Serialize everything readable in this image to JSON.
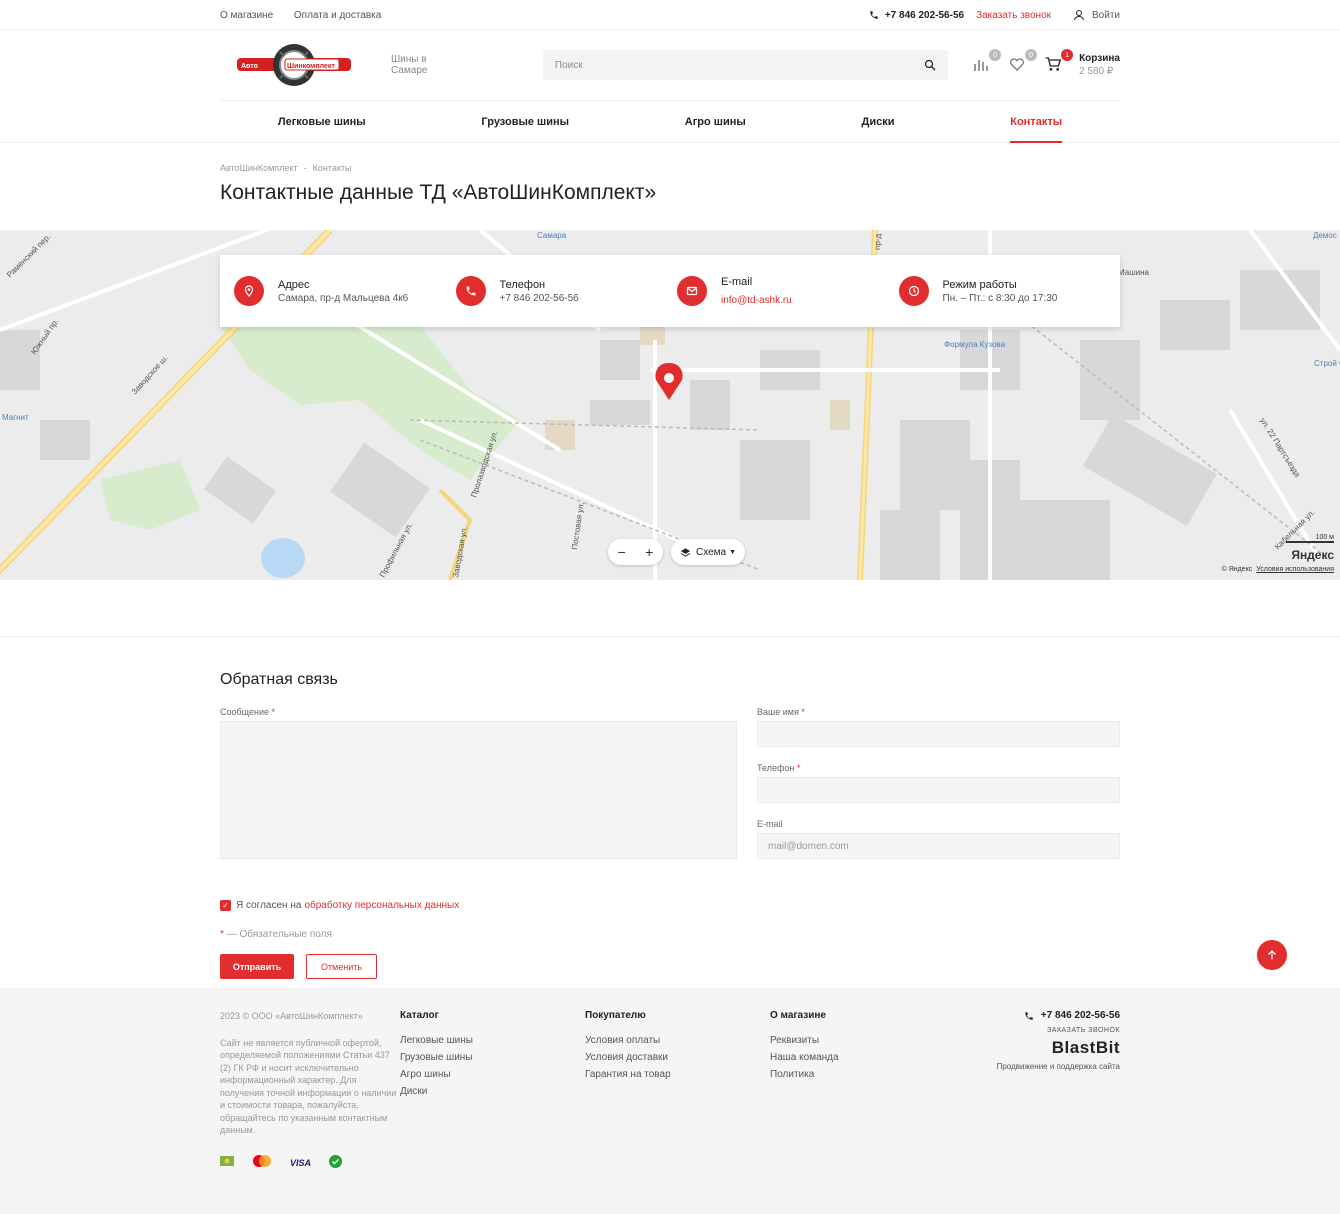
{
  "topbar": {
    "links": [
      "О магазине",
      "Оплата и доставка"
    ],
    "phone": "+7 846 202-56-56",
    "callback": "Заказать звонок",
    "login": "Войти"
  },
  "header": {
    "logo_text_left": "Авто",
    "logo_text_right": "Шинкомплект",
    "slogan": "Шины в Самаре",
    "search_placeholder": "Поиск",
    "compare_count": "0",
    "favorites_count": "0",
    "cart_count": "1",
    "cart_label": "Корзина",
    "cart_total": "2 580 ₽"
  },
  "nav": {
    "items": [
      "Легковые шины",
      "Грузовые шины",
      "Агро шины",
      "Диски",
      "Контакты"
    ],
    "active": "Контакты"
  },
  "breadcrumbs": [
    "АвтоШинКомплект",
    "Контакты"
  ],
  "breadcrumb_sep": "-",
  "page_title": "Контактные данные ТД «АвтоШинКомплект»",
  "contacts": {
    "address_title": "Адрес",
    "address_value": "Самара, пр-д Мальцева 4к6",
    "phone_title": "Телефон",
    "phone_value": "+7 846 202-56-56",
    "email_title": "E-mail",
    "email_value": "info@td-ashk.ru",
    "hours_title": "Режим работы",
    "hours_value": "Пн. – Пт.: с 8:30 до 17:30"
  },
  "map": {
    "labels": [
      "Самара",
      "Заводское ш.",
      "Магнит",
      "Формула Кузова",
      "Машина",
      "Демос",
      "Строй Сат",
      "ул. 22 Партсъезда",
      "Кабельная ул.",
      "Профильная ул.",
      "Заводская ул.",
      "Пролазводская ул.",
      "Постовая ул.",
      "Южный пр.",
      "Раменский пер.",
      "пр-д"
    ],
    "zoom_minus": "−",
    "zoom_plus": "+",
    "layer_label": "Схема",
    "scale": "100 м",
    "brand": "Яндекс",
    "copyright": "© Яндекс",
    "terms": "Условия использования"
  },
  "feedback": {
    "title": "Обратная связь",
    "message_label": "Сообщение",
    "name_label": "Ваше имя",
    "phone_label": "Телефон",
    "email_label": "E-mail",
    "email_placeholder": "mail@domen.com",
    "required_mark": "*",
    "agree_text": "Я согласен на",
    "agree_link": "обработку персональных данных",
    "required_note": "— Обязательные поля",
    "submit": "Отправить",
    "cancel": "Отменить"
  },
  "footer": {
    "copyright": "2023 © ООО «АвтоШинКомплект»",
    "disclaimer": "Сайт не является публичной офертой, определяемой положениями Статьи 437 (2) ГК РФ и носит исключительно информационный характер. Для получения точной информации о наличии и стоимости товара, пожалуйста, обращайтесь по указанным контактным данным.",
    "columns": [
      {
        "title": "Каталог",
        "items": [
          "Легковые шины",
          "Грузовые шины",
          "Агро шины",
          "Диски"
        ]
      },
      {
        "title": "Покупателю",
        "items": [
          "Условия оплаты",
          "Условия доставки",
          "Гарантия на товар"
        ]
      },
      {
        "title": "О магазине",
        "items": [
          "Реквизиты",
          "Наша команда",
          "Политика"
        ]
      }
    ],
    "phone": "+7 846 202-56-56",
    "callback": "ЗАКАЗАТЬ ЗВОНОК",
    "dev_brand": "BlastBit",
    "dev_text": "Продвижение и поддержка сайта",
    "payments": [
      "VISA"
    ]
  },
  "colors": {
    "accent": "#e12d2d",
    "footer_bg": "#f5f5f5",
    "map_bg": "#ececec"
  }
}
